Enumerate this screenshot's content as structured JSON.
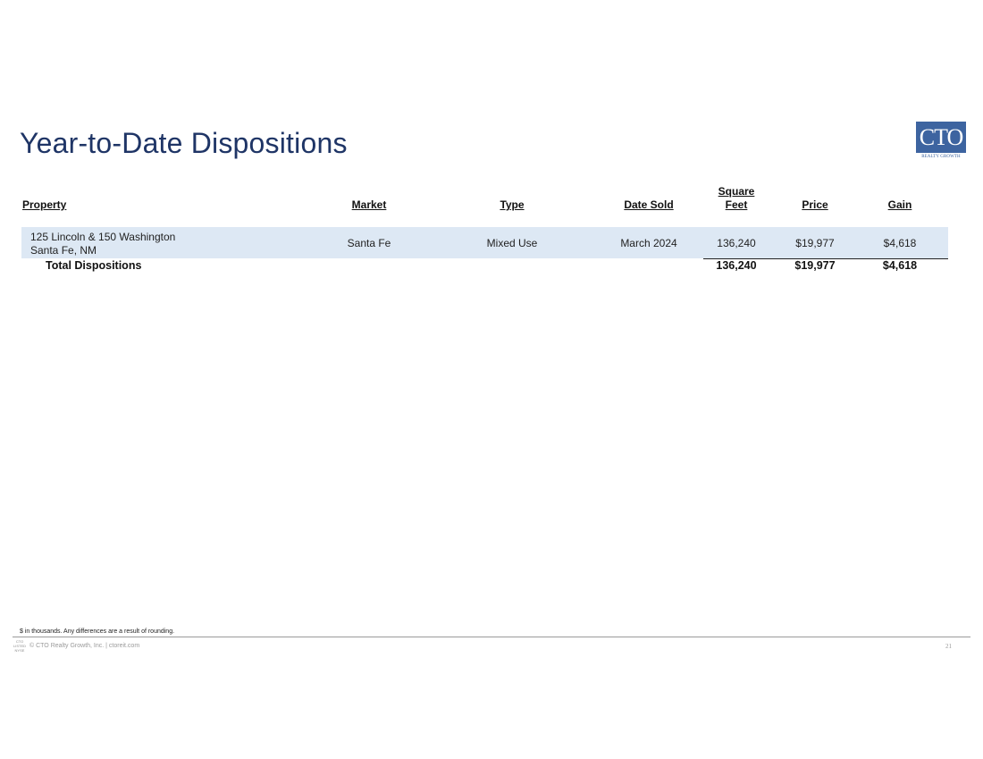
{
  "page": {
    "title": "Year-to-Date Dispositions",
    "page_number": "21"
  },
  "logo": {
    "text": "CTO",
    "subtext": "REALTY GROWTH",
    "color": "#3d64a0"
  },
  "table": {
    "headers": {
      "property": "Property",
      "market": "Market",
      "type": "Type",
      "date_sold": "Date Sold",
      "square_feet_line1": "Square",
      "square_feet_line2": "Feet",
      "price": "Price",
      "gain": "Gain"
    },
    "rows": [
      {
        "property_line1": "125 Lincoln & 150 Washington",
        "property_line2": "Santa Fe, NM",
        "market": "Santa Fe",
        "type": "Mixed Use",
        "date_sold": "March 2024",
        "square_feet": "136,240",
        "price": "$19,977",
        "gain": "$4,618"
      }
    ],
    "total": {
      "label": "Total Dispositions",
      "square_feet": "136,240",
      "price": "$19,977",
      "gain": "$4,618"
    },
    "row_highlight_color": "#dde8f4"
  },
  "footer": {
    "footnote": "$ in thousands. Any differences are a result of rounding.",
    "ticker_mark_line1": "CTO",
    "ticker_mark_line2": "LISTED",
    "ticker_mark_line3": "NYSE",
    "copyright": "© CTO Realty Growth, Inc. | ctoreit.com"
  },
  "colors": {
    "title": "#1f3566",
    "accent": "#3d64a0"
  }
}
